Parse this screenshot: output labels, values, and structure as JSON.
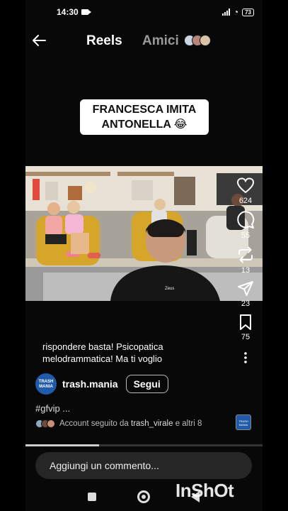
{
  "status_bar": {
    "time": "14:30",
    "battery": "73"
  },
  "nav": {
    "tab_reels": "Reels",
    "tab_amici": "Amici"
  },
  "overlay_caption": {
    "line1": "FRANCESCA IMITA",
    "line2": "ANTONELLA 😂"
  },
  "video_overlay": {
    "shirt_text": "Zeus"
  },
  "actions": {
    "likes": "624",
    "comments": "55",
    "reposts": "13",
    "shares": "23",
    "saves": "75"
  },
  "post": {
    "description_line1": "rispondere basta! Psicopatica",
    "description_line2": "melodrammatica! Ma ti voglio",
    "author": "trash.mania",
    "author_avatar_text": "TRASH MANIA",
    "follow_label": "Segui",
    "hashtag": "#gfvip ...",
    "followed_prefix": "Account seguito da",
    "followed_user": "trash_virale",
    "followed_suffix": "e altri 8",
    "audio_thumb_text": "TRASH MANIA",
    "progress": 0.31
  },
  "comment_input": {
    "placeholder": "Aggiungi un commento..."
  },
  "watermark": "InShOt",
  "icons": [
    "back-arrow-icon",
    "heart-icon",
    "comment-icon",
    "repost-icon",
    "share-icon",
    "bookmark-icon",
    "more-icon"
  ]
}
